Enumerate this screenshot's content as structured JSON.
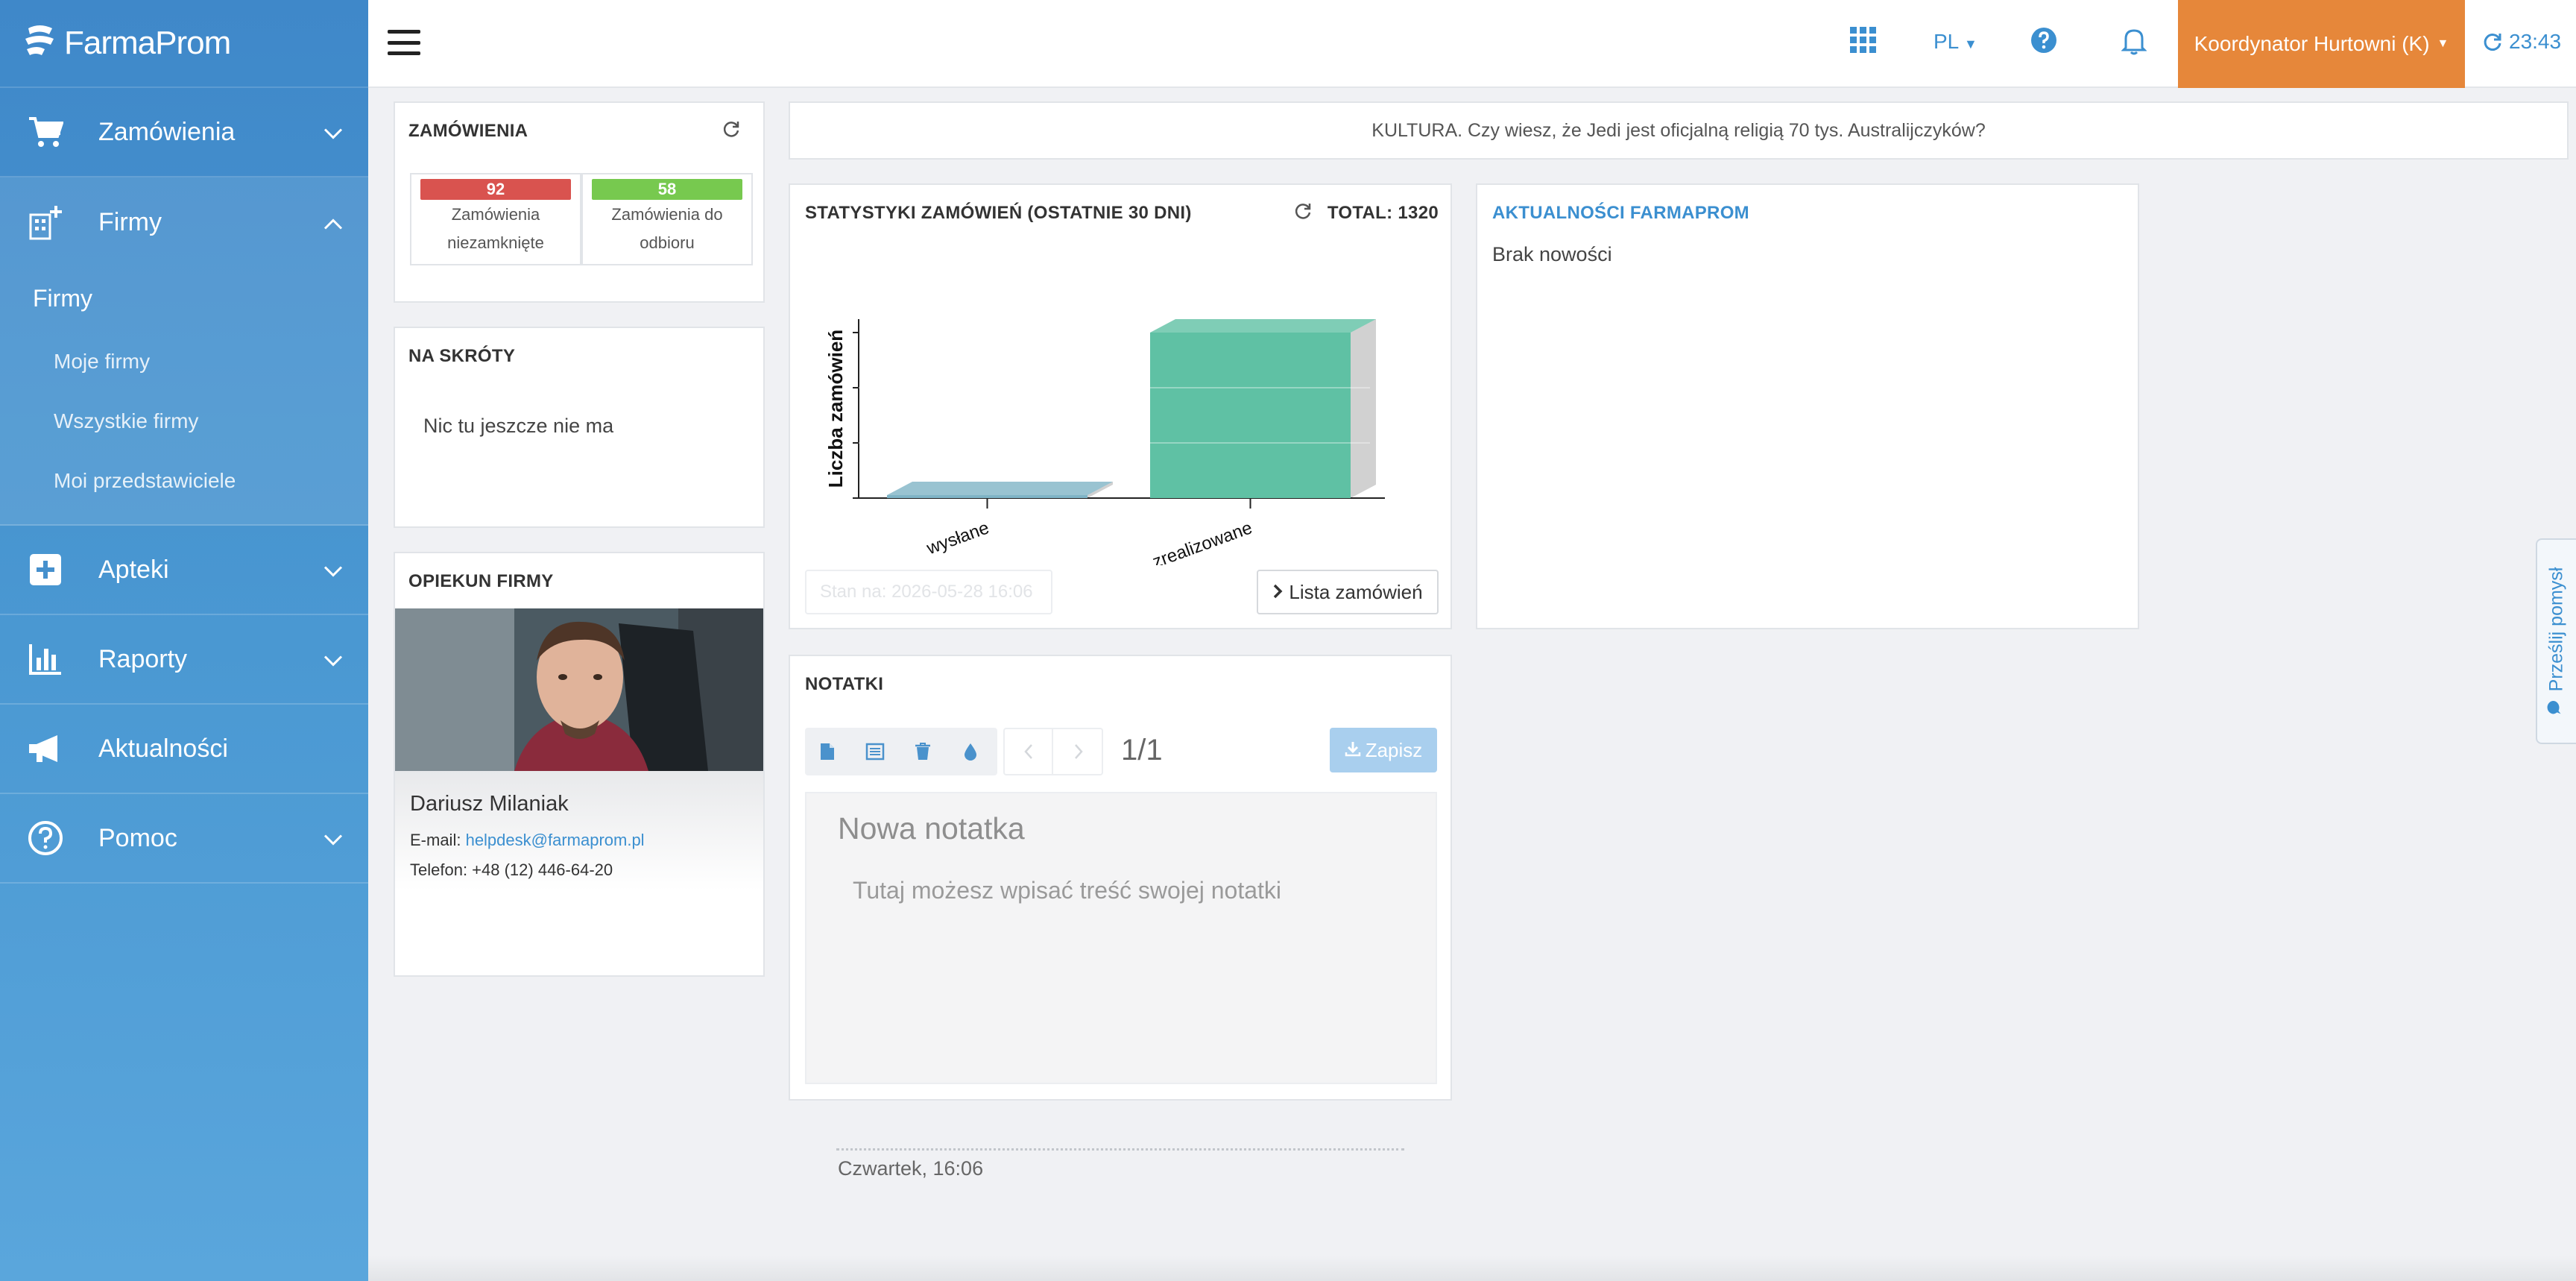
{
  "app": {
    "logo_text": "FarmaProm"
  },
  "sidebar": {
    "items": [
      {
        "label": "Zamówienia"
      },
      {
        "label": "Firmy"
      },
      {
        "label": "Apteki"
      },
      {
        "label": "Raporty"
      },
      {
        "label": "Aktualności"
      },
      {
        "label": "Pomoc"
      }
    ],
    "submenu": {
      "heading": "Firmy",
      "links": [
        "Moje firmy",
        "Wszystkie firmy",
        "Moi przedstawiciele"
      ]
    }
  },
  "topbar": {
    "language": "PL",
    "user_role": "Koordynator Hurtowni (K)",
    "time": "23:43"
  },
  "orders_panel": {
    "title": "ZAMÓWIENIA",
    "stats": [
      {
        "count": "92",
        "label_line1": "Zamówienia",
        "label_line2": "niezamknięte",
        "color": "#d9534f"
      },
      {
        "count": "58",
        "label_line1": "Zamówienia do",
        "label_line2": "odbioru",
        "color": "#77c94f"
      }
    ]
  },
  "shortcuts_panel": {
    "title": "NA SKRÓTY",
    "empty_text": "Nic tu jeszcze nie ma"
  },
  "caretaker_panel": {
    "title": "OPIEKUN FIRMY",
    "name": "Dariusz Milaniak",
    "email_label": "E-mail:",
    "email": "helpdesk@farmaprom.pl",
    "phone": "Telefon: +48 (12) 446-64-20"
  },
  "banner": {
    "text": "KULTURA. Czy wiesz, że Jedi jest oficjalną religią 70 tys. Australijczyków?"
  },
  "stats_panel": {
    "title": "STATYSTYKI ZAMÓWIEŃ (OSTATNIE 30 DNI)",
    "total": "TOTAL: 1320",
    "status_text": "Stan na: 2026-05-28 16:06",
    "list_button": "Lista zamówień"
  },
  "chart_data": {
    "type": "bar",
    "categories": [
      "wysłane",
      "zrealizowane"
    ],
    "values": [
      0,
      1320
    ],
    "ylabel": "Liczba zamówień",
    "colors": [
      "#7fb4c6",
      "#5fc1a4"
    ]
  },
  "news_panel": {
    "title": "AKTUALNOŚCI FARMAPROM",
    "text": "Brak nowości"
  },
  "notes_panel": {
    "title": "NOTATKI",
    "pager": "1/1",
    "save_label": "Zapisz",
    "note_title_placeholder": "Nowa notatka",
    "note_body_placeholder": "Tutaj możesz wpisać treść swojej notatki"
  },
  "footer": {
    "date_text": "Czwartek, 16:06"
  },
  "feedback_tab": {
    "label": "Prześlij pomysł"
  }
}
